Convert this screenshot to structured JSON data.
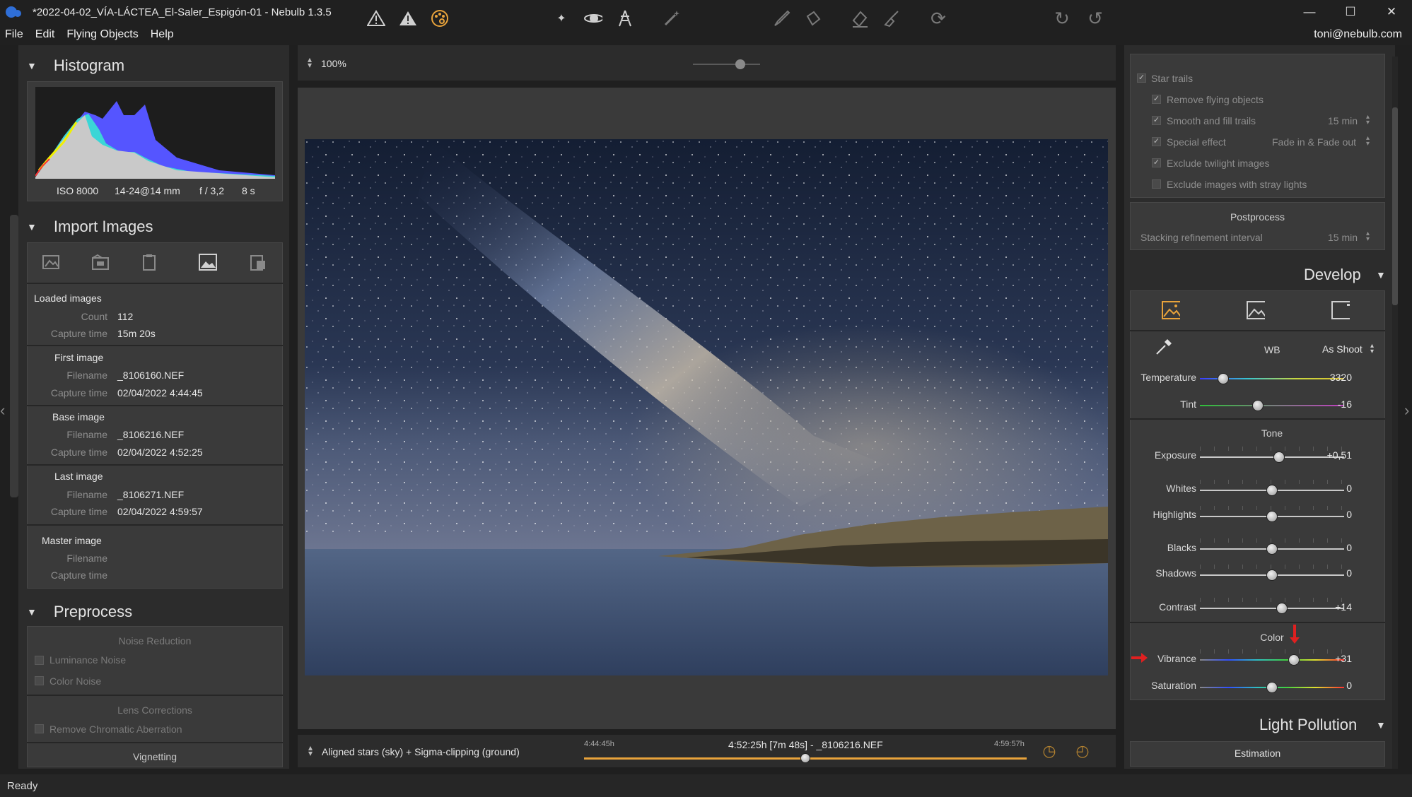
{
  "window": {
    "title": "*2022-04-02_VÍA-LÁCTEA_El-Saler_Espigón-01 - Nebulb 1.3.5",
    "minimize": "—",
    "maximize": "☐",
    "close": "✕"
  },
  "menu": {
    "items": [
      "File",
      "Edit",
      "Flying Objects",
      "Help"
    ],
    "user": "toni@nebulb.com"
  },
  "histogram": {
    "title": "Histogram",
    "iso": "ISO 8000",
    "lens": "14-24@14 mm",
    "aperture": "f / 3,2",
    "exposure": "8 s"
  },
  "import": {
    "title": "Import Images",
    "loaded": {
      "heading": "Loaded images",
      "count_label": "Count",
      "count": "112",
      "capture_label": "Capture time",
      "capture": "15m 20s"
    },
    "first": {
      "heading": "First image",
      "filename_label": "Filename",
      "filename": "_8106160.NEF",
      "capture_label": "Capture time",
      "capture": "02/04/2022 4:44:45"
    },
    "base": {
      "heading": "Base image",
      "filename_label": "Filename",
      "filename": "_8106216.NEF",
      "capture_label": "Capture time",
      "capture": "02/04/2022 4:52:25"
    },
    "last": {
      "heading": "Last image",
      "filename_label": "Filename",
      "filename": "_8106271.NEF",
      "capture_label": "Capture time",
      "capture": "02/04/2022 4:59:57"
    },
    "master": {
      "heading": "Master image",
      "filename_label": "Filename",
      "capture_label": "Capture time"
    }
  },
  "preprocess": {
    "title": "Preprocess",
    "noise_title": "Noise Reduction",
    "luminance": "Luminance Noise",
    "color_noise": "Color Noise",
    "lens_title": "Lens Corrections",
    "chromatic": "Remove Chromatic Aberration",
    "vignetting": "Vignetting"
  },
  "toolbar": {
    "zoom": "100%"
  },
  "stack": {
    "mode": "Aligned stars (sky) + Sigma-clipping (ground)",
    "start": "4:44:45h",
    "current": "4:52:25h [7m 48s] - _8106216.NEF",
    "end": "4:59:57h",
    "position": 0.5
  },
  "star_trails": {
    "title": "Star trails",
    "remove_flying": "Remove flying objects",
    "smooth": "Smooth and fill trails",
    "smooth_value": "15 min",
    "special": "Special effect",
    "special_value": "Fade in & Fade out",
    "exclude_twilight": "Exclude twilight images",
    "exclude_stray": "Exclude images with stray lights"
  },
  "postprocess": {
    "title": "Postprocess",
    "stacking_label": "Stacking refinement interval",
    "stacking_value": "15 min"
  },
  "develop": {
    "title": "Develop",
    "wb_label": "WB",
    "wb_value": "As Shoot",
    "temperature_label": "Temperature",
    "temperature": "3320",
    "temperature_pos": 0.16,
    "tint_label": "Tint",
    "tint": "-16",
    "tint_pos": 0.4,
    "tone_title": "Tone",
    "exposure_label": "Exposure",
    "exposure": "+0,51",
    "exposure_pos": 0.55,
    "whites_label": "Whites",
    "whites": "0",
    "whites_pos": 0.5,
    "highlights_label": "Highlights",
    "highlights": "0",
    "highlights_pos": 0.5,
    "blacks_label": "Blacks",
    "blacks": "0",
    "blacks_pos": 0.5,
    "shadows_label": "Shadows",
    "shadows": "0",
    "shadows_pos": 0.5,
    "contrast_label": "Contrast",
    "contrast": "+14",
    "contrast_pos": 0.57,
    "color_title": "Color",
    "vibrance_label": "Vibrance",
    "vibrance": "+31",
    "vibrance_pos": 0.65,
    "saturation_label": "Saturation",
    "saturation": "0",
    "saturation_pos": 0.5
  },
  "light_pollution": {
    "title": "Light Pollution",
    "estimation": "Estimation"
  },
  "status": {
    "text": "Ready"
  },
  "colors": {
    "accent": "#e8a33b",
    "bg": "#1f1f1f",
    "panel": "#2c2c2c",
    "box": "#3a3a3a"
  }
}
